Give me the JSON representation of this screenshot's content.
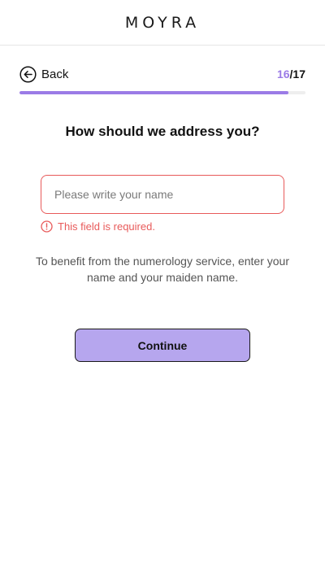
{
  "header": {
    "logo": "MOYRA"
  },
  "nav": {
    "back_label": "Back",
    "back_icon": "arrow-left-circle-icon"
  },
  "progress": {
    "current": "16",
    "separator_total": "/17",
    "fraction": 0.941,
    "color": "#9b7be6"
  },
  "question": {
    "title": "How should we address you?"
  },
  "name_input": {
    "value": "",
    "placeholder": "Please write your name"
  },
  "error": {
    "icon": "alert-circle-icon",
    "message": "This field is required.",
    "color": "#e85a5a"
  },
  "helper": {
    "text": "To benefit from the numerology service, enter your name and your maiden name."
  },
  "continue_button": {
    "label": "Continue",
    "background": "#b6a6ee"
  }
}
